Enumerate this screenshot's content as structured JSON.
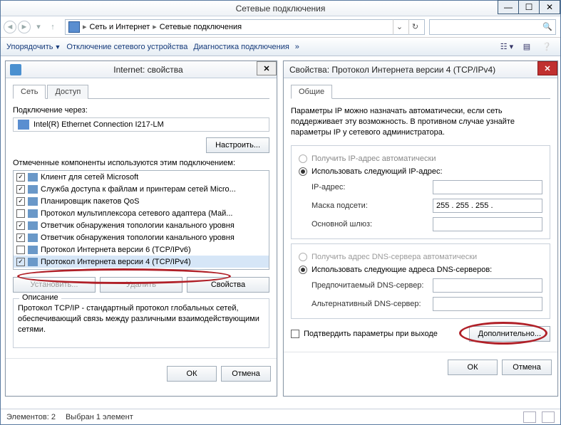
{
  "main": {
    "title": "Сетевые подключения",
    "breadcrumb": {
      "a": "Сеть и Интернет",
      "b": "Сетевые подключения"
    },
    "search_placeholder": "",
    "toolbar": {
      "organize": "Упорядочить",
      "disable": "Отключение сетевого устройства",
      "diagnose": "Диагностика подключения"
    },
    "status": {
      "count": "Элементов: 2",
      "selected": "Выбран 1 элемент"
    },
    "win": {
      "min": "—",
      "max": "☐",
      "close": "✕"
    }
  },
  "dlg1": {
    "title": "Internet: свойства",
    "tabs": {
      "net": "Сеть",
      "access": "Доступ"
    },
    "connect_label": "Подключение через:",
    "adapter": "Intel(R) Ethernet Connection I217-LM",
    "configure": "Настроить...",
    "components_label": "Отмеченные компоненты используются этим подключением:",
    "items": [
      {
        "checked": true,
        "label": "Клиент для сетей Microsoft"
      },
      {
        "checked": true,
        "label": "Служба доступа к файлам и принтерам сетей Micro..."
      },
      {
        "checked": true,
        "label": "Планировщик пакетов QoS"
      },
      {
        "checked": false,
        "label": "Протокол мультиплексора сетевого адаптера (Май..."
      },
      {
        "checked": true,
        "label": "Ответчик обнаружения топологии канального уровня"
      },
      {
        "checked": true,
        "label": "Ответчик обнаружения топологии канального уровня"
      },
      {
        "checked": false,
        "label": "Протокол Интернета версии 6 (TCP/IPv6)"
      },
      {
        "checked": true,
        "label": "Протокол Интернета версии 4 (TCP/IPv4)"
      }
    ],
    "install": "Установить...",
    "remove": "Удалить",
    "props": "Свойства",
    "desc_title": "Описание",
    "desc_text": "Протокол TCP/IP - стандартный протокол глобальных сетей, обеспечивающий связь между различными взаимодействующими сетями.",
    "ok": "ОК",
    "cancel": "Отмена"
  },
  "dlg2": {
    "title": "Свойства: Протокол Интернета версии 4 (TCP/IPv4)",
    "tab": "Общие",
    "note": "Параметры IP можно назначать автоматически, если сеть поддерживает эту возможность. В противном случае узнайте параметры IP у сетевого администратора.",
    "ip_auto": "Получить IP-адрес автоматически",
    "ip_manual": "Использовать следующий IP-адрес:",
    "ip_label": "IP-адрес:",
    "mask_label": "Маска подсети:",
    "mask_value": "255 . 255 . 255 .",
    "gw_label": "Основной шлюз:",
    "dns_auto": "Получить адрес DNS-сервера автоматически",
    "dns_manual": "Использовать следующие адреса DNS-серверов:",
    "dns1_label": "Предпочитаемый DNS-сервер:",
    "dns2_label": "Альтернативный DNS-сервер:",
    "confirm": "Подтвердить параметры при выходе",
    "advanced": "Дополнительно...",
    "ok": "ОК",
    "cancel": "Отмена"
  }
}
